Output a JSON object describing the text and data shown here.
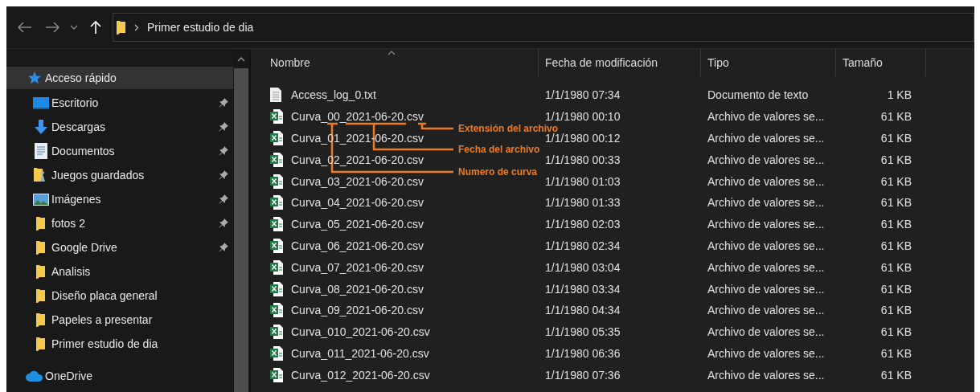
{
  "address_bar": {
    "path": "Primer estudio de dia"
  },
  "sidebar": {
    "items": [
      {
        "label": "Acceso rápido",
        "kind": "quick",
        "pinned": false,
        "selected": true
      },
      {
        "label": "Escritorio",
        "kind": "desktop",
        "pinned": true,
        "selected": false
      },
      {
        "label": "Descargas",
        "kind": "download",
        "pinned": true,
        "selected": false
      },
      {
        "label": "Documentos",
        "kind": "documents",
        "pinned": true,
        "selected": false
      },
      {
        "label": "Juegos guardados",
        "kind": "games",
        "pinned": true,
        "selected": false
      },
      {
        "label": "Imágenes",
        "kind": "pictures",
        "pinned": true,
        "selected": false
      },
      {
        "label": "fotos 2",
        "kind": "folder",
        "pinned": true,
        "selected": false
      },
      {
        "label": "Google Drive",
        "kind": "folder",
        "pinned": true,
        "selected": false
      },
      {
        "label": "Analisis",
        "kind": "folder",
        "pinned": false,
        "selected": false
      },
      {
        "label": "Diseño placa general",
        "kind": "folder",
        "pinned": false,
        "selected": false
      },
      {
        "label": "Papeles a presentar",
        "kind": "folder",
        "pinned": false,
        "selected": false
      },
      {
        "label": "Primer estudio de dia",
        "kind": "folder",
        "pinned": false,
        "selected": false
      },
      {
        "label": "OneDrive",
        "kind": "onedrive",
        "pinned": false,
        "selected": false
      }
    ]
  },
  "table": {
    "columns": [
      "Nombre",
      "Fecha de modificación",
      "Tipo",
      "Tamaño"
    ],
    "rows": [
      {
        "kind": "text",
        "name": "Access_log_0.txt",
        "modified": "1/1/1980 07:34",
        "type": "Documento de texto",
        "size": "1 KB"
      },
      {
        "kind": "csv",
        "name": "Curva_00_2021-06-20.csv",
        "modified": "1/1/1980 00:10",
        "type": "Archivo de valores se...",
        "size": "61 KB"
      },
      {
        "kind": "csv",
        "name": "Curva_01_2021-06-20.csv",
        "modified": "1/1/1980 00:12",
        "type": "Archivo de valores se...",
        "size": "61 KB"
      },
      {
        "kind": "csv",
        "name": "Curva_02_2021-06-20.csv",
        "modified": "1/1/1980 00:33",
        "type": "Archivo de valores se...",
        "size": "61 KB"
      },
      {
        "kind": "csv",
        "name": "Curva_03_2021-06-20.csv",
        "modified": "1/1/1980 01:03",
        "type": "Archivo de valores se...",
        "size": "61 KB"
      },
      {
        "kind": "csv",
        "name": "Curva_04_2021-06-20.csv",
        "modified": "1/1/1980 01:33",
        "type": "Archivo de valores se...",
        "size": "61 KB"
      },
      {
        "kind": "csv",
        "name": "Curva_05_2021-06-20.csv",
        "modified": "1/1/1980 02:03",
        "type": "Archivo de valores se...",
        "size": "61 KB"
      },
      {
        "kind": "csv",
        "name": "Curva_06_2021-06-20.csv",
        "modified": "1/1/1980 02:34",
        "type": "Archivo de valores se...",
        "size": "61 KB"
      },
      {
        "kind": "csv",
        "name": "Curva_07_2021-06-20.csv",
        "modified": "1/1/1980 03:04",
        "type": "Archivo de valores se...",
        "size": "61 KB"
      },
      {
        "kind": "csv",
        "name": "Curva_08_2021-06-20.csv",
        "modified": "1/1/1980 03:34",
        "type": "Archivo de valores se...",
        "size": "61 KB"
      },
      {
        "kind": "csv",
        "name": "Curva_09_2021-06-20.csv",
        "modified": "1/1/1980 04:34",
        "type": "Archivo de valores se...",
        "size": "61 KB"
      },
      {
        "kind": "csv",
        "name": "Curva_010_2021-06-20.csv",
        "modified": "1/1/1980 05:35",
        "type": "Archivo de valores se...",
        "size": "61 KB"
      },
      {
        "kind": "csv",
        "name": "Curva_011_2021-06-20.csv",
        "modified": "1/1/1980 06:36",
        "type": "Archivo de valores se...",
        "size": "61 KB"
      },
      {
        "kind": "csv",
        "name": "Curva_012_2021-06-20.csv",
        "modified": "1/1/1980 07:36",
        "type": "Archivo de valores se...",
        "size": "61 KB"
      }
    ]
  },
  "annotations": [
    {
      "label": "Extensión del archivo",
      "kind": "extension"
    },
    {
      "label": "Fecha del archivo",
      "kind": "date"
    },
    {
      "label": "Numero de curva",
      "kind": "number"
    }
  ]
}
